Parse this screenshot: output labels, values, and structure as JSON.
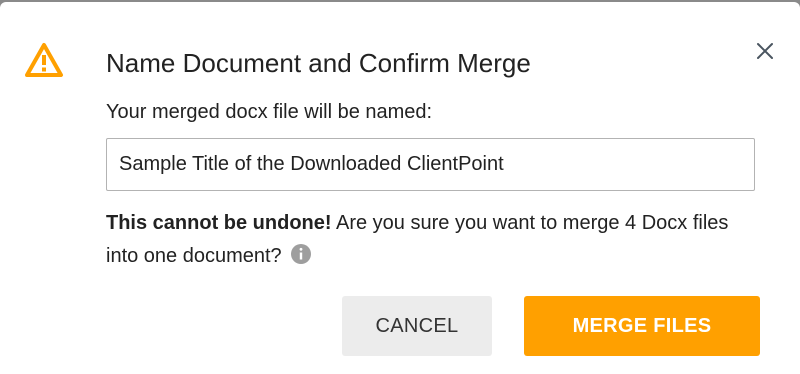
{
  "dialog": {
    "title": "Name Document and Confirm Merge",
    "filename_label": "Your merged docx file will be named:",
    "filename_value": "Sample Title of the Downloaded ClientPoint",
    "warning_bold": "This cannot be undone!",
    "warning_text": " Are you sure you want to merge 4 Docx files into one document?",
    "cancel_label": "CANCEL",
    "merge_label": "MERGE FILES"
  },
  "icons": {
    "warning": "warning-triangle-icon",
    "close": "close-icon",
    "info": "info-icon"
  },
  "colors": {
    "accent": "#ffa000",
    "cancel_bg": "#ececec",
    "text": "#222222",
    "info_icon": "#9e9e9e"
  }
}
